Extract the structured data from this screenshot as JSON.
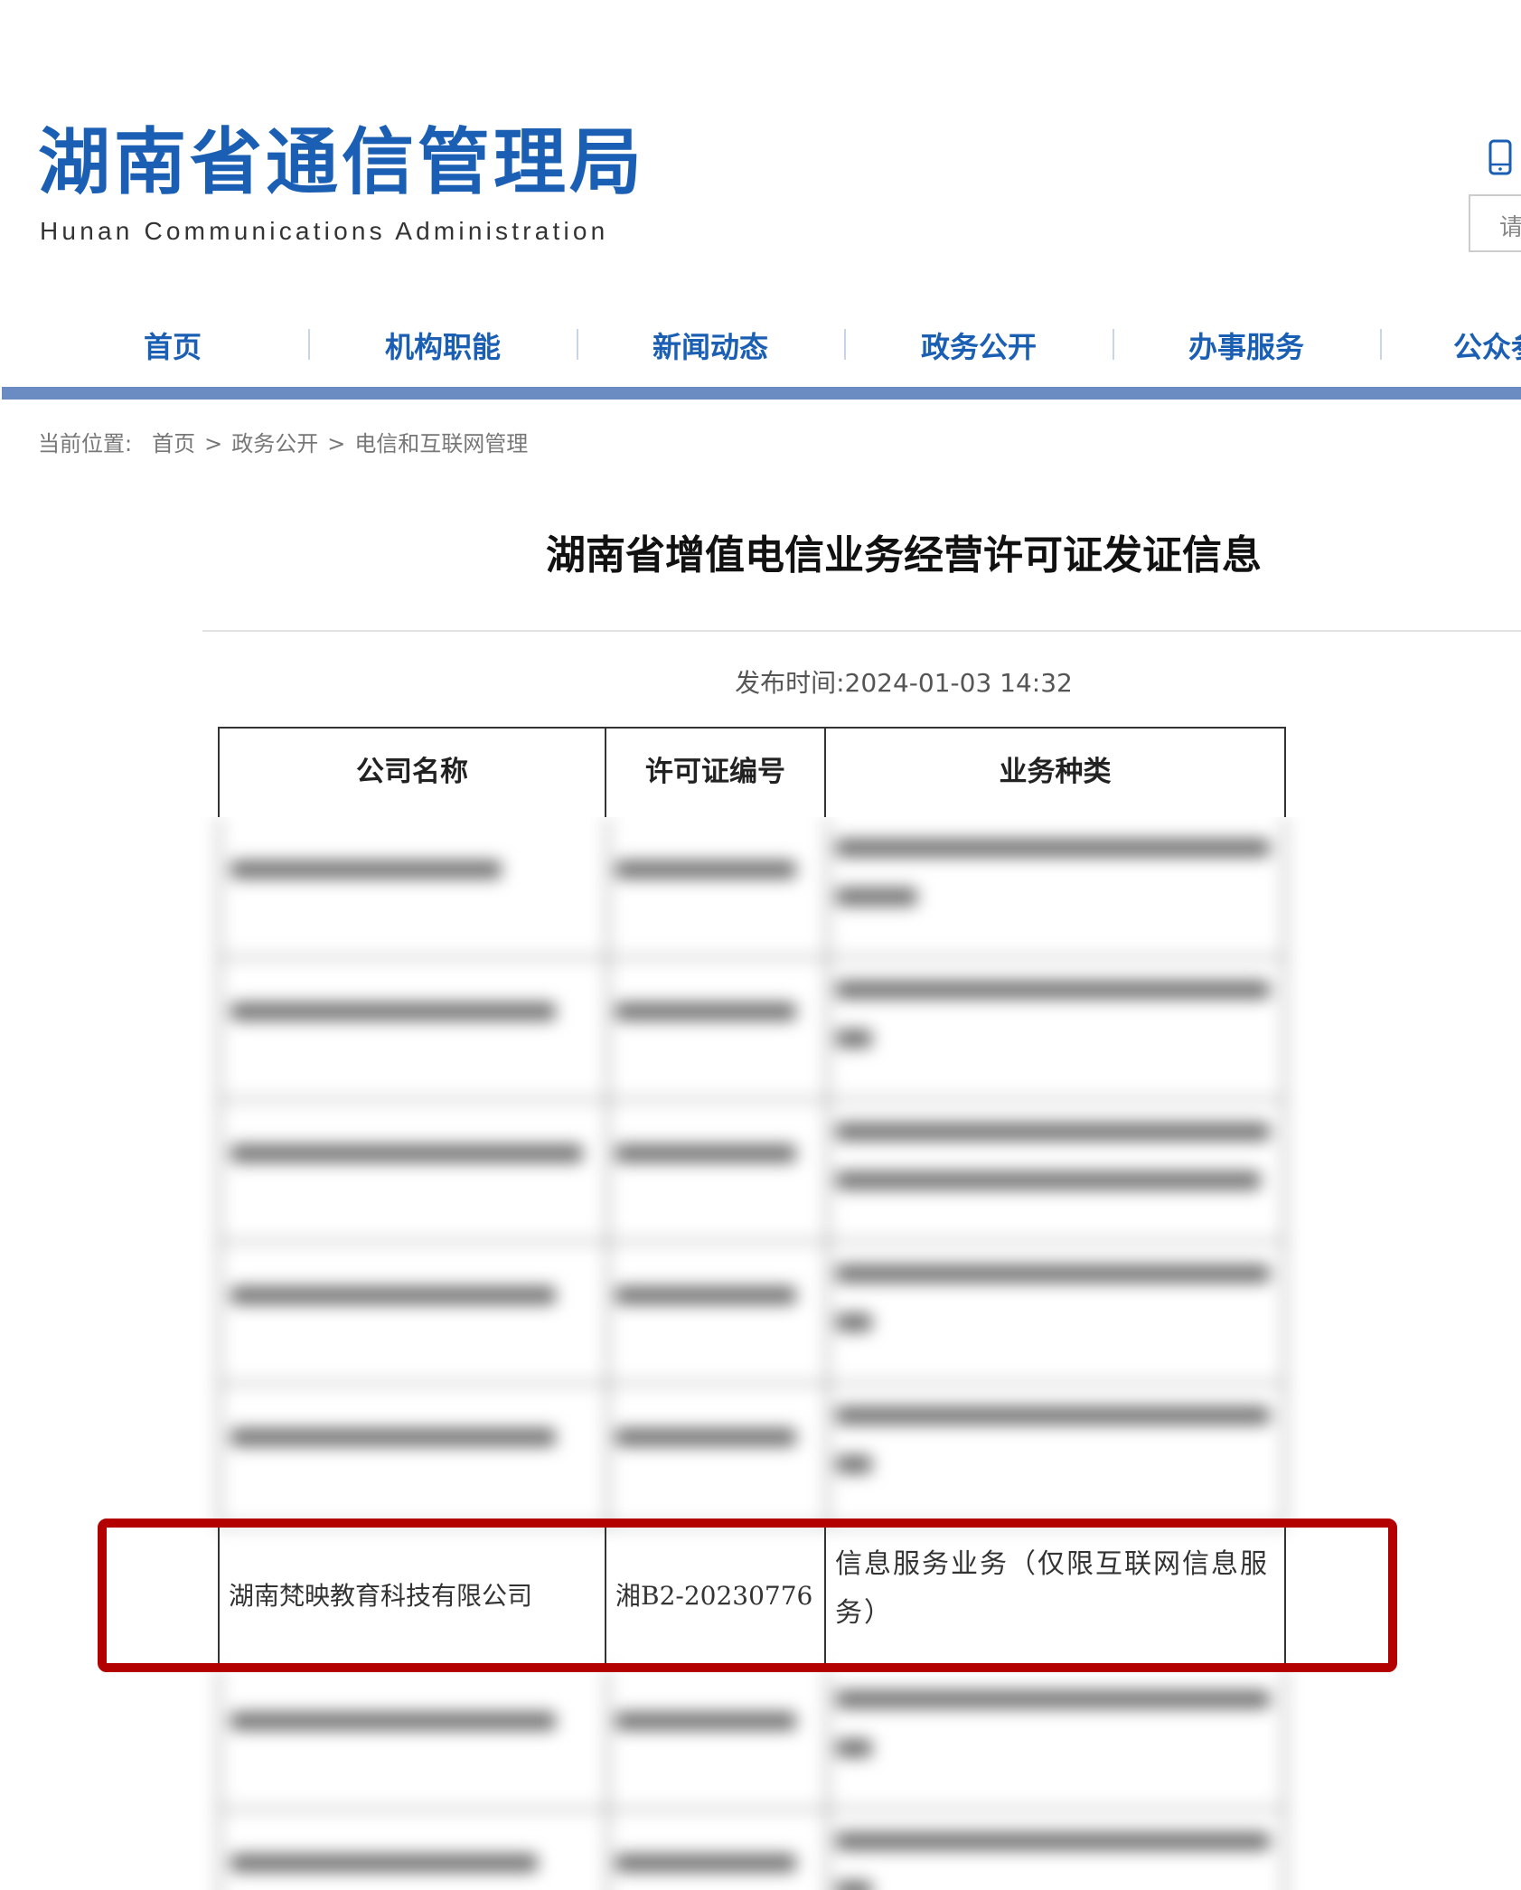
{
  "header": {
    "title_cn": "湖南省通信管理局",
    "title_en": "Hunan Communications Administration",
    "search_placeholder": "请"
  },
  "nav": {
    "items": [
      "首页",
      "机构职能",
      "新闻动态",
      "政务公开",
      "办事服务",
      "公众参与"
    ]
  },
  "breadcrumb": {
    "prefix": "当前位置:",
    "items": [
      "首页",
      "政务公开",
      "电信和互联网管理"
    ],
    "separator": ">"
  },
  "article": {
    "title": "湖南省增值电信业务经营许可证发证信息",
    "publish_label": "发布时间:",
    "publish_time": "2024-01-03 14:32"
  },
  "table": {
    "headers": [
      "公司名称",
      "许可证编号",
      "业务种类"
    ],
    "highlighted_row": {
      "company": "湖南梵映教育科技有限公司",
      "license": "湘B2-20230776",
      "business": "信息服务业务（仅限互联网信息服务）"
    }
  },
  "colors": {
    "brand_blue": "#1a5fb4",
    "nav_bar": "#6b8bc3",
    "highlight_red": "#b30000"
  }
}
